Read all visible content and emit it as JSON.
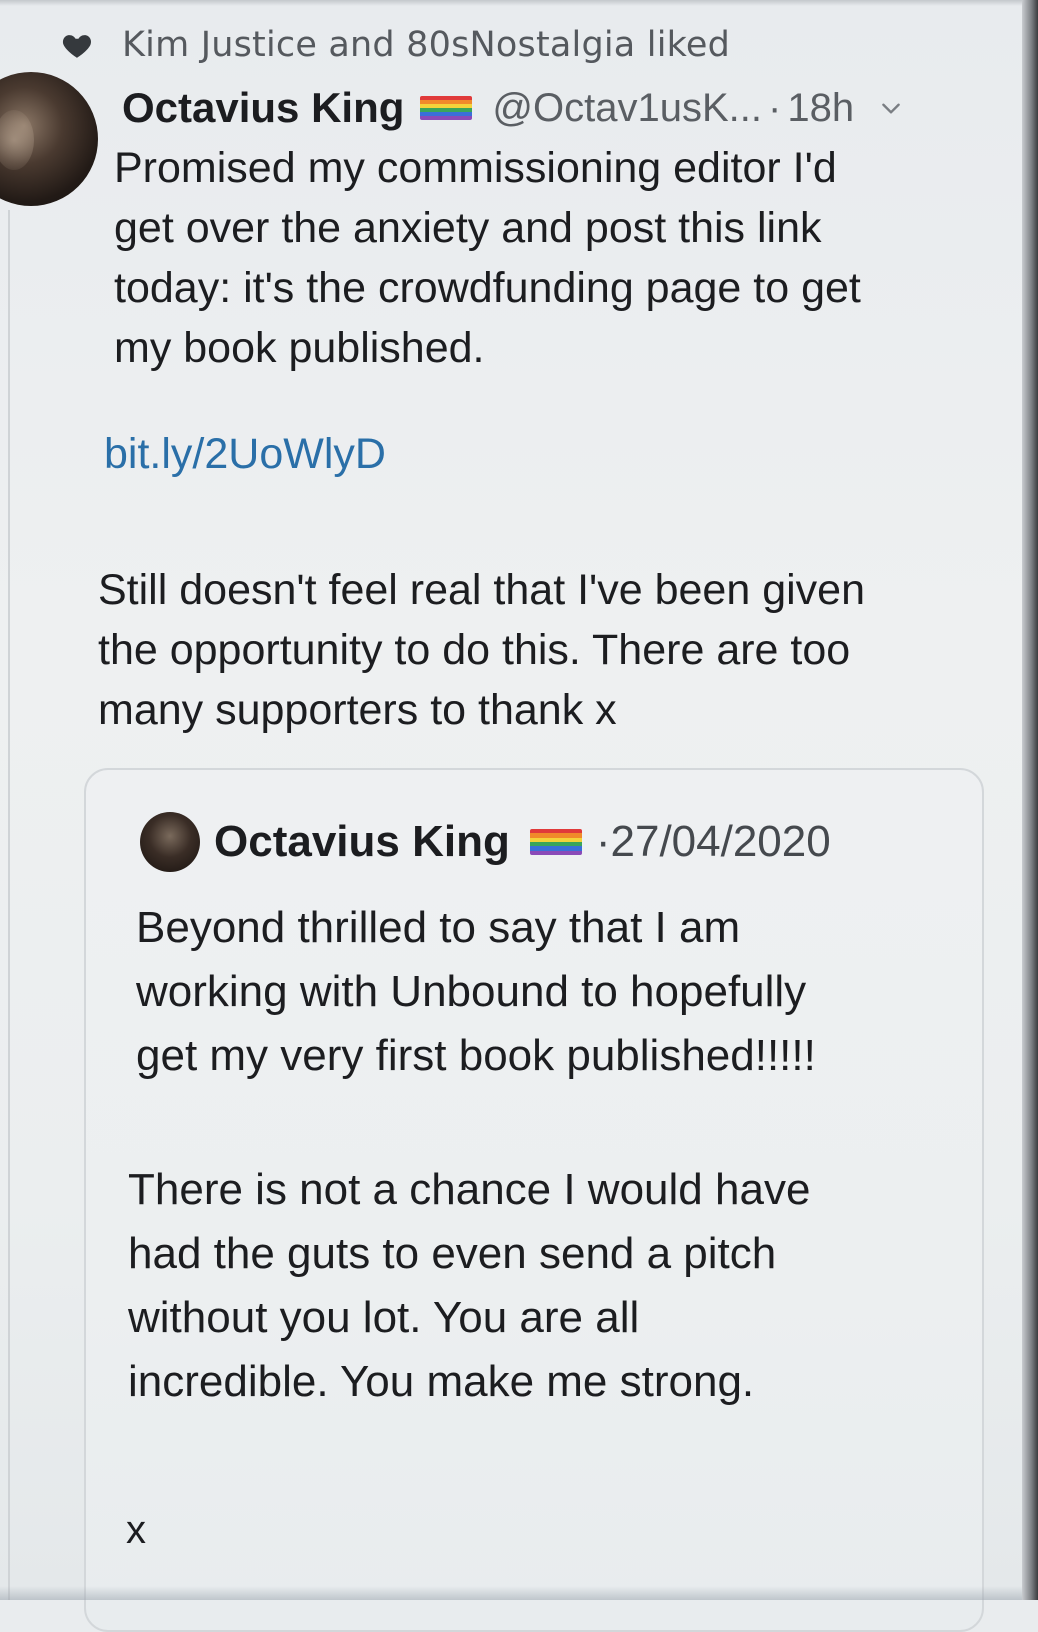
{
  "social_context": {
    "icon": "heart-icon",
    "text": "Kim Justice and 80sNostalgia liked"
  },
  "tweet": {
    "author_name": "Octavius King",
    "flag_icon": "rainbow-flag-icon",
    "handle": "@Octav1usK...",
    "separator": "·",
    "time": "18h",
    "text_1": "Promised my commissioning editor I'd\nget over the anxiety and post this link\ntoday: it's the crowdfunding page to get\nmy book published.",
    "link": "bit.ly/2UoWlyD",
    "text_2": "Still doesn't feel real that I've been given\nthe opportunity to do this. There are too\nmany supporters to thank x"
  },
  "quoted_tweet": {
    "author_name": "Octavius King",
    "separator": "·",
    "date": "27/04/2020",
    "text_1": "Beyond thrilled to say that I am\nworking with Unbound to hopefully\nget my very first book published!!!!!",
    "text_2": "There is not a chance I would have\nhad the guts to even send a pitch\nwithout you lot. You are all\nincredible. You make me strong.",
    "text_3": "x"
  },
  "colors": {
    "link": "#2a6fa8",
    "secondary_text": "#5a5e63",
    "rainbow": [
      "#e03a3a",
      "#f08a2a",
      "#f3d33a",
      "#3aa55a",
      "#3a6fd8",
      "#8a4ab8"
    ]
  }
}
